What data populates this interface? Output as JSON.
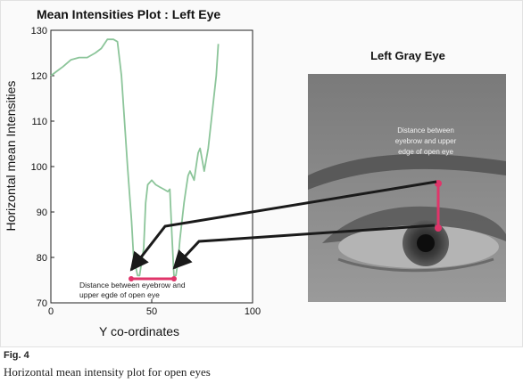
{
  "chart_data": {
    "type": "line",
    "title": "Mean Intensities Plot : Left Eye",
    "xlabel": "Y co-ordinates",
    "ylabel": "Horizontal mean Intensities",
    "xlim": [
      0,
      100
    ],
    "ylim": [
      70,
      130
    ],
    "xticks": [
      0,
      50,
      100
    ],
    "yticks": [
      70,
      80,
      90,
      100,
      110,
      120,
      130
    ],
    "series": [
      {
        "color": "#8cc59a",
        "x": [
          0,
          3,
          6,
          10,
          14,
          18,
          22,
          25,
          28,
          31,
          33,
          35,
          38,
          40,
          41,
          43,
          44,
          46,
          47,
          48,
          50,
          52,
          54,
          56,
          58,
          59,
          60,
          61,
          62,
          63,
          64,
          65,
          66,
          67,
          68,
          69,
          71,
          72,
          73,
          74,
          76,
          78,
          80,
          82,
          83
        ],
        "y": [
          120,
          121,
          122,
          123.5,
          124,
          124,
          125,
          126,
          128,
          128,
          127.5,
          120,
          100,
          88,
          80,
          76,
          76,
          82,
          92,
          96,
          97,
          96,
          95.5,
          95,
          94.5,
          95,
          85,
          76,
          76,
          79,
          84,
          88,
          92,
          95,
          98,
          99,
          97,
          100,
          103,
          104,
          99,
          104,
          112,
          120,
          127
        ]
      }
    ],
    "annotations": {
      "distance_label": [
        "Distance between eyebrow and",
        "upper egde of open eye"
      ],
      "arrow_color": "#1a1a1a",
      "marker_color": "#e0356a"
    },
    "inset": {
      "title": "Left Gray Eye",
      "label": [
        "Distance between",
        "eyebrow and upper",
        "edge of open eye"
      ]
    }
  },
  "figure": {
    "label": "Fig. 4",
    "caption": "Horizontal mean intensity plot for open eyes"
  }
}
